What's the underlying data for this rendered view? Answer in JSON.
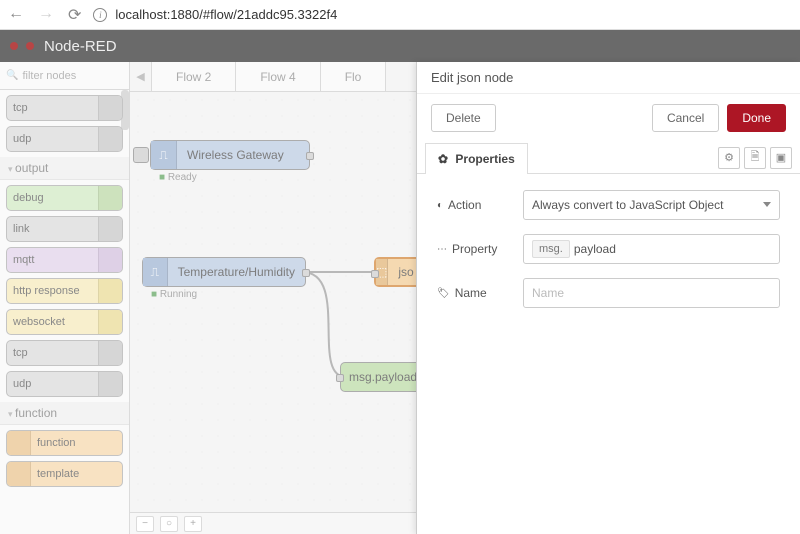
{
  "browser": {
    "url": "localhost:1880/#flow/21addc95.3322f4"
  },
  "app": {
    "title": "Node-RED"
  },
  "palette": {
    "filter_placeholder": "filter nodes",
    "top_nodes": [
      {
        "label": "tcp",
        "cls": "n-grey"
      },
      {
        "label": "udp",
        "cls": "n-grey"
      }
    ],
    "cat_output": "output",
    "output_nodes": [
      {
        "label": "debug",
        "cls": "n-green"
      },
      {
        "label": "link",
        "cls": "n-grey"
      },
      {
        "label": "mqtt",
        "cls": "n-purple"
      },
      {
        "label": "http response",
        "cls": "n-yellow"
      },
      {
        "label": "websocket",
        "cls": "n-yellow"
      },
      {
        "label": "tcp",
        "cls": "n-grey"
      },
      {
        "label": "udp",
        "cls": "n-grey"
      }
    ],
    "cat_function": "function",
    "function_nodes": [
      {
        "label": "function",
        "cls": "n-orange"
      },
      {
        "label": "template",
        "cls": "n-orange"
      }
    ]
  },
  "tabs": {
    "t1": "Flow 2",
    "t2": "Flow 4",
    "t3": "Flo"
  },
  "canvas": {
    "gateway": {
      "label": "Wireless Gateway",
      "status": "Ready"
    },
    "temp": {
      "label": "Temperature/Humidity",
      "status": "Running"
    },
    "json": {
      "label": "jso"
    },
    "debug": {
      "label": "msg.payload"
    }
  },
  "edit": {
    "title": "Edit json node",
    "delete": "Delete",
    "cancel": "Cancel",
    "done": "Done",
    "tab_properties": "Properties",
    "action_label": "Action",
    "action_value": "Always convert to JavaScript Object",
    "property_label": "Property",
    "property_prefix": "msg.",
    "property_value": "payload",
    "name_label": "Name",
    "name_placeholder": "Name"
  }
}
